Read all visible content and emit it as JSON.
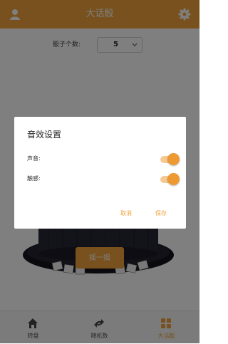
{
  "header": {
    "title": "大话骰",
    "user_icon": "user-icon",
    "settings_icon": "gear-icon"
  },
  "dice_count": {
    "label": "骰子个数:",
    "value": "5"
  },
  "main": {
    "shake_label": "摇一摇"
  },
  "tabbar": {
    "tabs": [
      {
        "label": "转盘",
        "icon": "home-icon",
        "active": false
      },
      {
        "label": "随机数",
        "icon": "shuffle-icon",
        "active": false
      },
      {
        "label": "大话骰",
        "icon": "dice-icon",
        "active": true
      }
    ]
  },
  "dialog": {
    "title": "音效设置",
    "settings": [
      {
        "label": "声音:",
        "enabled": true
      },
      {
        "label": "触感:",
        "enabled": true
      }
    ],
    "cancel_label": "取消",
    "save_label": "保存"
  },
  "colors": {
    "accent": "#f0a23c",
    "overlay": "rgba(0,0,0,0.5)"
  }
}
